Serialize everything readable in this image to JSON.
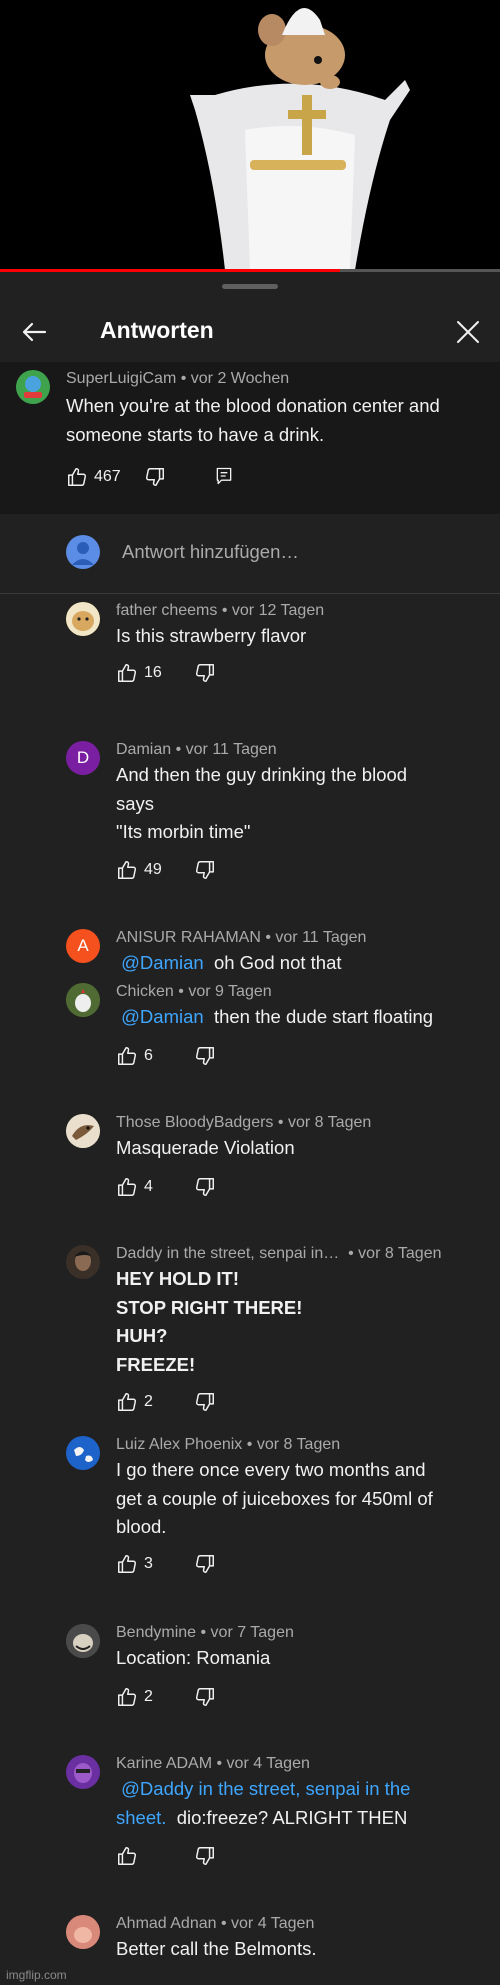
{
  "video": {
    "progress_percent": 68
  },
  "header": {
    "title": "Antworten"
  },
  "parent": {
    "author": "SuperLuigiCam",
    "time": "vor 2 Wochen",
    "text_lines": [
      "When you're at the blood donation center and",
      "someone starts to have a drink."
    ],
    "likes": "467"
  },
  "add_reply": {
    "placeholder": "Antwort hinzufügen…"
  },
  "replies": [
    {
      "author": "father cheems",
      "time": "vor 12 Tagen",
      "lines": [
        [
          "Is this strawberry flavor"
        ]
      ],
      "likes": "16"
    },
    {
      "author": "Damian",
      "avatar_letter": "D",
      "time": "vor 11 Tagen",
      "lines": [
        [
          "And then the guy drinking the blood"
        ],
        [
          "says"
        ],
        [
          "\"Its morbin time\""
        ]
      ],
      "likes": "49"
    },
    {
      "author": "ANISUR RAHAMAN",
      "avatar_letter": "A",
      "time": "vor 11 Tagen",
      "mention": "@Damian",
      "text": "oh God not that"
    },
    {
      "author": "Chicken",
      "time": "vor 9 Tagen",
      "mention": "@Damian",
      "text": "then the dude start floating",
      "likes": "6"
    },
    {
      "author": "Those BloodyBadgers",
      "time": "vor 8 Tagen",
      "lines": [
        [
          "Masquerade Violation"
        ]
      ],
      "likes": "4"
    },
    {
      "author": "Daddy in the street, senpai in…",
      "time": "vor 8 Tagen",
      "lines": [
        [
          "HEY HOLD IT!"
        ],
        [
          "STOP RIGHT THERE!"
        ],
        [
          "HUH?"
        ],
        [
          "FREEZE!"
        ]
      ],
      "likes": "2"
    },
    {
      "author": "Luiz Alex Phoenix",
      "time": "vor 8 Tagen",
      "lines": [
        [
          "I go there once every two months and"
        ],
        [
          "get a couple of juiceboxes for 450ml of"
        ],
        [
          "blood."
        ]
      ],
      "likes": "3"
    },
    {
      "author": "Bendymine",
      "time": "vor 7 Tagen",
      "lines": [
        [
          "Location: Romania"
        ]
      ],
      "likes": "2"
    },
    {
      "author": "Karine ADAM",
      "time": "vor 4 Tagen",
      "mention_line1": "@Daddy in the street, senpai in the",
      "mention_line2": "sheet.",
      "text": "dio:freeze? ALRIGHT THEN"
    },
    {
      "author": "Ahmad Adnan",
      "time": "vor 4 Tagen",
      "lines": [
        [
          "Better call the Belmonts."
        ]
      ]
    }
  ],
  "watermark": "imgflip.com",
  "colors": {
    "mention": "#3ea6ff",
    "progress": "#ff0000",
    "sheet": "#212121",
    "parent_bg": "#181818"
  }
}
